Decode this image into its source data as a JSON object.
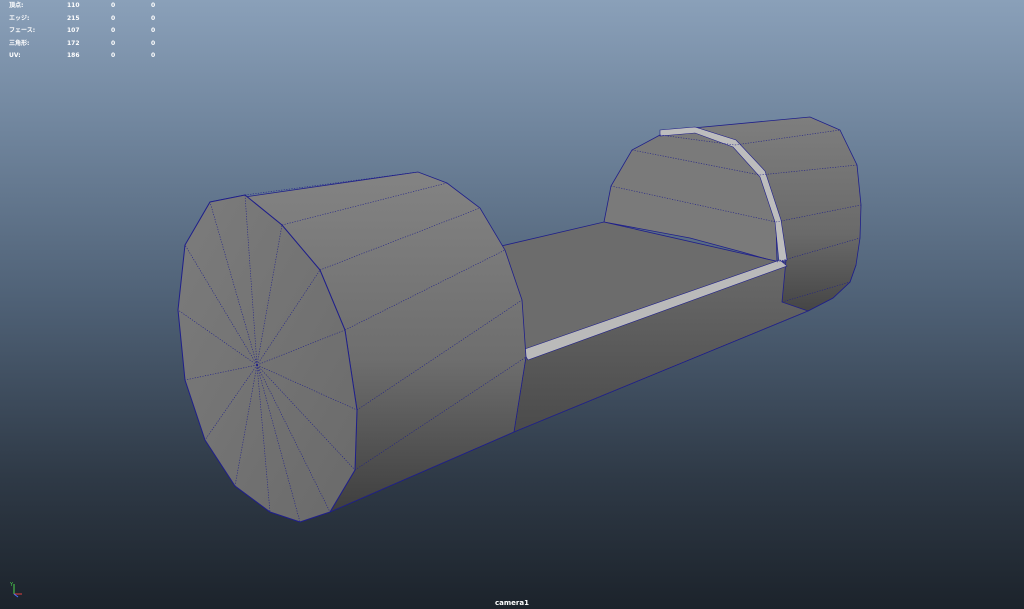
{
  "hud": {
    "rows": [
      {
        "label": "頂点:",
        "v1": "110",
        "v2": "0",
        "v3": "0"
      },
      {
        "label": "エッジ:",
        "v1": "215",
        "v2": "0",
        "v3": "0"
      },
      {
        "label": "フェース:",
        "v1": "107",
        "v2": "0",
        "v3": "0"
      },
      {
        "label": "三角形:",
        "v1": "172",
        "v2": "0",
        "v3": "0"
      },
      {
        "label": "UV:",
        "v1": "186",
        "v2": "0",
        "v3": "0"
      }
    ]
  },
  "camera": {
    "label": "camera1"
  },
  "axis": {
    "y_label": "Y",
    "x_label": "X",
    "z_label": "Z"
  },
  "colors": {
    "wire": "#1f1f8a",
    "hud_text": "#ffffff"
  }
}
